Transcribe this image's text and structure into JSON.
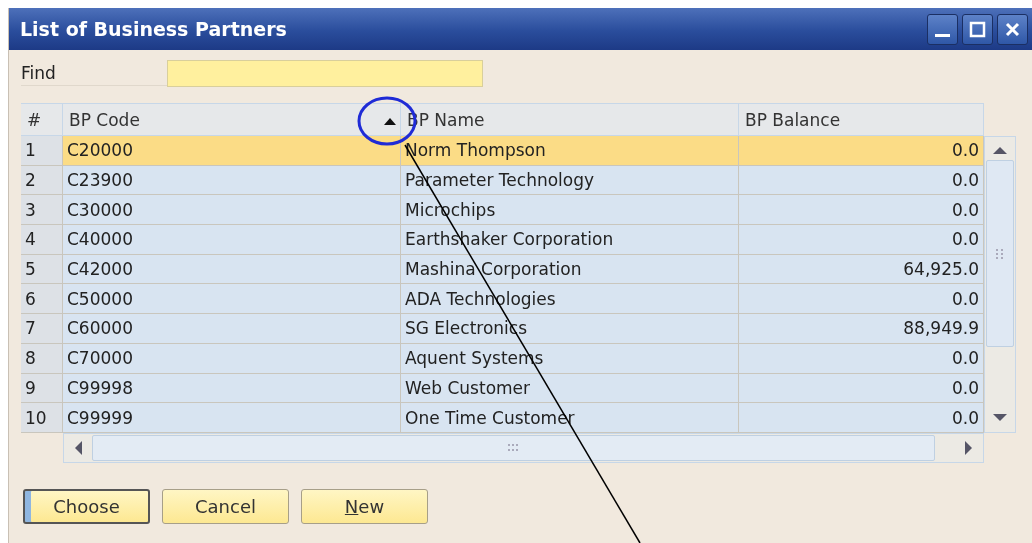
{
  "window": {
    "title": "List of Business Partners"
  },
  "find": {
    "label": "Find"
  },
  "table": {
    "columns": [
      {
        "label": "#",
        "sorted": false
      },
      {
        "label": "BP Code",
        "sorted": true
      },
      {
        "label": "BP Name",
        "sorted": false
      },
      {
        "label": "BP Balance",
        "sorted": false
      }
    ],
    "rows": [
      {
        "cells": [
          "1",
          "C20000",
          "Norm Thompson",
          "0.0"
        ],
        "selected": true
      },
      {
        "cells": [
          "2",
          "C23900",
          "Parameter Technology",
          "0.0"
        ],
        "selected": false
      },
      {
        "cells": [
          "3",
          "C30000",
          "Microchips",
          "0.0"
        ],
        "selected": false
      },
      {
        "cells": [
          "4",
          "C40000",
          "Earthshaker Corporation",
          "0.0"
        ],
        "selected": false
      },
      {
        "cells": [
          "5",
          "C42000",
          "Mashina Corporation",
          "64,925.0"
        ],
        "selected": false
      },
      {
        "cells": [
          "6",
          "C50000",
          "ADA Technologies",
          "0.0"
        ],
        "selected": false
      },
      {
        "cells": [
          "7",
          "C60000",
          "SG Electronics",
          "88,949.9"
        ],
        "selected": false
      },
      {
        "cells": [
          "8",
          "C70000",
          "Aquent Systems",
          "0.0"
        ],
        "selected": false
      },
      {
        "cells": [
          "9",
          "C99998",
          "Web Customer",
          "0.0"
        ],
        "selected": false
      },
      {
        "cells": [
          "10",
          "C99999",
          "One Time Customer",
          "0.0"
        ],
        "selected": false
      }
    ]
  },
  "buttons": [
    {
      "label": "Choose",
      "default": true,
      "underline_first": false
    },
    {
      "label": "Cancel",
      "default": false,
      "underline_first": false
    },
    {
      "label": "New",
      "default": false,
      "underline_first": true
    }
  ]
}
